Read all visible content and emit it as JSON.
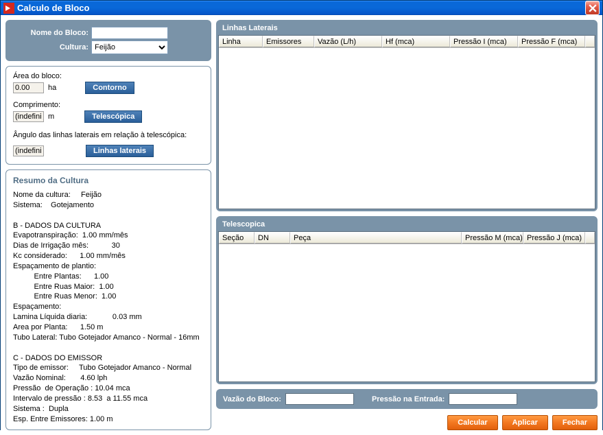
{
  "window": {
    "title": "Calculo de Bloco"
  },
  "header": {
    "nome_label": "Nome do Bloco:",
    "nome_value": "",
    "cultura_label": "Cultura:",
    "cultura_selected": "Feijão"
  },
  "params": {
    "area_label": "Área do bloco:",
    "area_value": "0.00",
    "area_unit": "ha",
    "contorno_btn": "Contorno",
    "comp_label": "Comprimento:",
    "comp_value": "(indefini",
    "comp_unit": "m",
    "telescopica_btn": "Telescópica",
    "angulo_label": "Ângulo das linhas laterais em relação à telescópica:",
    "angulo_value": "(indefini",
    "laterais_btn": "Linhas laterais"
  },
  "resumo": {
    "title": "Resumo da Cultura",
    "body": "Nome da cultura:     Feijão\nSistema:    Gotejamento\n\nB - DADOS DA CULTURA\nEvapotranspiração:  1.00 mm/mês\nDias de Irrigação mês:           30\nKc considerado:      1.00 mm/mês\nEspaçamento de plantio:\n          Entre Plantas:      1.00\n          Entre Ruas Maior:  1.00\n          Entre Ruas Menor:  1.00\nEspaçamento:\nLamina Líquida diaria:            0.03 mm\nArea por Planta:      1.50 m\nTubo Lateral: Tubo Gotejador Amanco - Normal - 16mm\n\nC - DADOS DO EMISSOR\nTipo de emissor:     Tubo Gotejador Amanco - Normal\nVazão Nominal:       4.60 lph\nPressão  de Operação : 10.04 mca\nIntervalo de pressão : 8.53  a 11.55 mca\nSistema :  Dupla\nEsp. Entre Emissores: 1.00 m"
  },
  "laterais": {
    "title": "Linhas Laterais",
    "cols": [
      "Linha",
      "Emissores",
      "Vazão (L/h)",
      "Hf (mca)",
      "Pressão I (mca)",
      "Pressão F (mca)"
    ]
  },
  "telescopica": {
    "title": "Telescopica",
    "cols": [
      "Seção",
      "DN",
      "Peça",
      "Pressão M (mca)",
      "Pressão J (mca)"
    ]
  },
  "footer": {
    "vazao_label": "Vazão do Bloco:",
    "pressao_label": "Pressão na Entrada:"
  },
  "buttons": {
    "calcular": "Calcular",
    "aplicar": "Aplicar",
    "fechar": "Fechar"
  }
}
